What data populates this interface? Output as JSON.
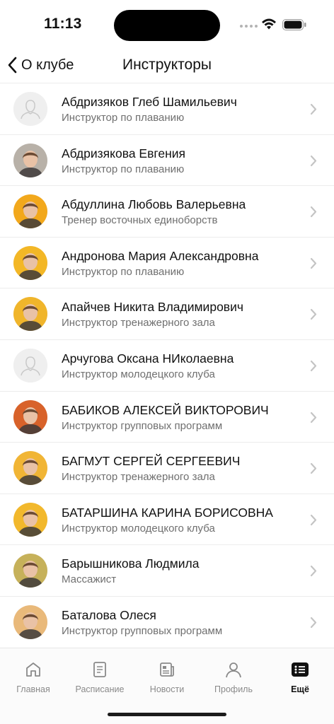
{
  "status_bar": {
    "time": "11:13"
  },
  "nav": {
    "back_label": "О клубе",
    "title": "Инструкторы"
  },
  "instructors": [
    {
      "name": "Абдризяков Глеб Шамильевич",
      "role": "Инструктор по плаванию",
      "avatar": "placeholder-person-icon",
      "color": "#e9e9e9"
    },
    {
      "name": "Абдризякова Евгения",
      "role": "Инструктор по плаванию",
      "avatar": "photo",
      "color": "#b8b1a8"
    },
    {
      "name": "Абдуллина Любовь Валерьевна",
      "role": "Тренер восточных единоборств",
      "avatar": "photo",
      "color": "#f2a81c"
    },
    {
      "name": "Андронова Мария Александровна",
      "role": "Инструктор по плаванию",
      "avatar": "photo",
      "color": "#f3b726"
    },
    {
      "name": "Апайчев Никита Владимирович",
      "role": "Инструктор тренажерного зала",
      "avatar": "photo",
      "color": "#f0b52b"
    },
    {
      "name": "Арчугова Оксана НИколаевна",
      "role": "Инструктор молодецкого клуба",
      "avatar": "placeholder-person-icon",
      "color": "#e9e9e9"
    },
    {
      "name": "БАБИКОВ АЛЕКСЕЙ ВИКТОРОВИЧ",
      "role": "Инструктор групповых программ",
      "avatar": "photo",
      "color": "#d8622a"
    },
    {
      "name": "БАГМУТ СЕРГЕЙ СЕРГЕЕВИЧ",
      "role": "Инструктор тренажерного зала",
      "avatar": "photo",
      "color": "#f1b535"
    },
    {
      "name": "БАТАРШИНА КАРИНА БОРИСОВНА",
      "role": "Инструктор молодецкого клуба",
      "avatar": "photo",
      "color": "#f2b82c"
    },
    {
      "name": "Барышникова Людмила",
      "role": "Массажист",
      "avatar": "photo",
      "color": "#c6b15a"
    },
    {
      "name": "Баталова Олеся",
      "role": "Инструктор групповых программ",
      "avatar": "photo",
      "color": "#e9b97a"
    }
  ],
  "tabbar": {
    "tabs": [
      {
        "label": "Главная",
        "icon": "home-icon",
        "active": false
      },
      {
        "label": "Расписание",
        "icon": "schedule-icon",
        "active": false
      },
      {
        "label": "Новости",
        "icon": "news-icon",
        "active": false
      },
      {
        "label": "Профиль",
        "icon": "profile-icon",
        "active": false
      },
      {
        "label": "Ещё",
        "icon": "more-list-icon",
        "active": true
      }
    ]
  },
  "colors": {
    "text_primary": "#111111",
    "text_secondary": "#6f6f6f",
    "tab_inactive": "#8a8a8a",
    "chevron": "#c4c4c4"
  }
}
